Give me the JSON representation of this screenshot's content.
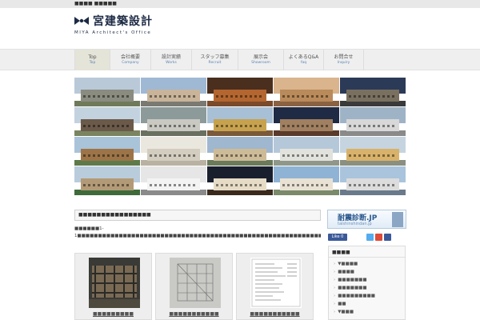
{
  "topbar": {
    "text": "■■■■ ■■■■■"
  },
  "header": {
    "title": "宮建築設計",
    "subtitle": "MIYA Architect's Office",
    "brand_color": "#1c2a44"
  },
  "nav": {
    "items": [
      {
        "jp": "Top",
        "en": "Top"
      },
      {
        "jp": "会社概要",
        "en": "Company"
      },
      {
        "jp": "設計実績",
        "en": "Works"
      },
      {
        "jp": "スタッフ募集",
        "en": "Recruit"
      },
      {
        "jp": "展示会",
        "en": "Showroom"
      },
      {
        "jp": "よくあるQ&A",
        "en": "faq"
      },
      {
        "jp": "お問合せ",
        "en": "Inquiry"
      }
    ]
  },
  "gallery": {
    "tiles": [
      {
        "name": "gallery-photo-1",
        "sky": "#b9c9d8",
        "bldg": "#8a8c80",
        "ground": "#6f7a5a"
      },
      {
        "name": "gallery-photo-2",
        "sky": "#9fb9d4",
        "bldg": "#c9b49a",
        "ground": "#7a7a72"
      },
      {
        "name": "gallery-photo-3",
        "sky": "#4a2e1e",
        "bldg": "#b3662f",
        "ground": "#7a4a2a"
      },
      {
        "name": "gallery-photo-4",
        "sky": "#d9b48c",
        "bldg": "#b98a5a",
        "ground": "#8a6242"
      },
      {
        "name": "gallery-photo-5",
        "sky": "#2b3a56",
        "bldg": "#7a7060",
        "ground": "#3a3a3a"
      },
      {
        "name": "gallery-photo-6",
        "sky": "#c3d2df",
        "bldg": "#6b5a4a",
        "ground": "#7a8460"
      },
      {
        "name": "gallery-photo-7",
        "sky": "#8c9a9a",
        "bldg": "#c9c9c2",
        "ground": "#6a7060"
      },
      {
        "name": "gallery-photo-8",
        "sky": "#a8c0d6",
        "bldg": "#c7a24e",
        "ground": "#7a5a3a"
      },
      {
        "name": "gallery-photo-9",
        "sky": "#1f2a44",
        "bldg": "#a08060",
        "ground": "#5a3a2a"
      },
      {
        "name": "gallery-photo-10",
        "sky": "#9fb3c7",
        "bldg": "#d8d8d8",
        "ground": "#8a8a8a"
      },
      {
        "name": "gallery-photo-11",
        "sky": "#a9c3d9",
        "bldg": "#9c7448",
        "ground": "#5e7a4a"
      },
      {
        "name": "gallery-photo-12",
        "sky": "#eae7df",
        "bldg": "#d3cdbf",
        "ground": "#b9b2a2"
      },
      {
        "name": "gallery-photo-13",
        "sky": "#9fb7cf",
        "bldg": "#cdbb98",
        "ground": "#6a7a5a"
      },
      {
        "name": "gallery-photo-14",
        "sky": "#b5c8da",
        "bldg": "#e2e2dc",
        "ground": "#8f978a"
      },
      {
        "name": "gallery-photo-15",
        "sky": "#c6d4e0",
        "bldg": "#d8b26a",
        "ground": "#8a8f80"
      },
      {
        "name": "gallery-photo-16",
        "sky": "#b9ccdc",
        "bldg": "#b39a76",
        "ground": "#3f6b3a"
      },
      {
        "name": "gallery-photo-17",
        "sky": "#e6e6e6",
        "bldg": "#f3f3f3",
        "ground": "#8a8a8a"
      },
      {
        "name": "gallery-photo-18",
        "sky": "#1a1f2e",
        "bldg": "#e6dcc6",
        "ground": "#3a2a1e"
      },
      {
        "name": "gallery-photo-19",
        "sky": "#8fb3d4",
        "bldg": "#e9e2d4",
        "ground": "#7a8a6a"
      },
      {
        "name": "gallery-photo-20",
        "sky": "#a9c4dc",
        "bldg": "#dcdcdc",
        "ground": "#6a7a8a"
      }
    ]
  },
  "main": {
    "title": "■■■■■■■■■■■■■■■■",
    "text": "■■■■■■1-1■■■■■■■■■■■■■■■■■■■■■■■■■■■■■■■■■■■■■■■■■■■■■■■■■■■■■■■■■■■■■■■■■■■■■■■■■■■■■■■■■■■■■■■■■■■■■■■■■■■■■■■■■■■■■■■■■■■■■■■■■■■■■■■■■■■■■■■■■■■■■■■■■■■■■■■■■■■■■■■■■■■■■■■■■■■■■■■■■■■■■■■■■■■■■■■■■■■■■■■■■",
    "cards": [
      {
        "caption": "■■■■■■■■■"
      },
      {
        "caption": "■■■■■■■■■■■"
      },
      {
        "caption": "■■■■■■■■■■■"
      }
    ]
  },
  "sidebar": {
    "banner": {
      "title": "耐震診断.JP",
      "sub": "taishinshindan.jp"
    },
    "like_label": "Like 0",
    "category_title": "■■■■",
    "categories": [
      "▼■■■■",
      "■■■■",
      "■■■■■■■",
      "■■■■■■■",
      "■■■■■■■■■",
      "■■",
      "▼■■■"
    ]
  }
}
